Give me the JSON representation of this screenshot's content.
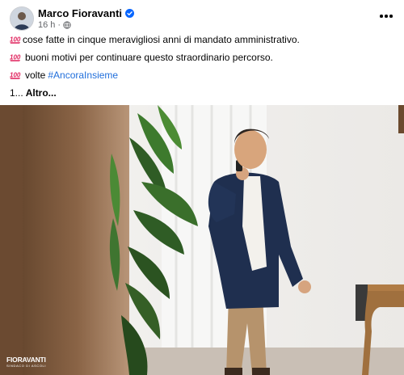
{
  "post": {
    "author": "Marco Fioravanti",
    "time": "16 h",
    "separator": "·",
    "emoji_icon": "hundred-points-emoji",
    "lines": [
      "cose fatte in cinque meravigliosi anni di mandato amministrativo.",
      "buoni motivi per continuare questo straordinario percorso.",
      "volte"
    ],
    "hashtag": "#AncoraInsieme",
    "truncation": "1...",
    "see_more": "Altro..."
  },
  "photo": {
    "watermark_title": "FIORAVANTI",
    "watermark_subtitle": "SINDACO DI ASCOLI"
  },
  "colors": {
    "link": "#216fdb",
    "verified": "#0866ff",
    "emoji": "#e0245e"
  }
}
